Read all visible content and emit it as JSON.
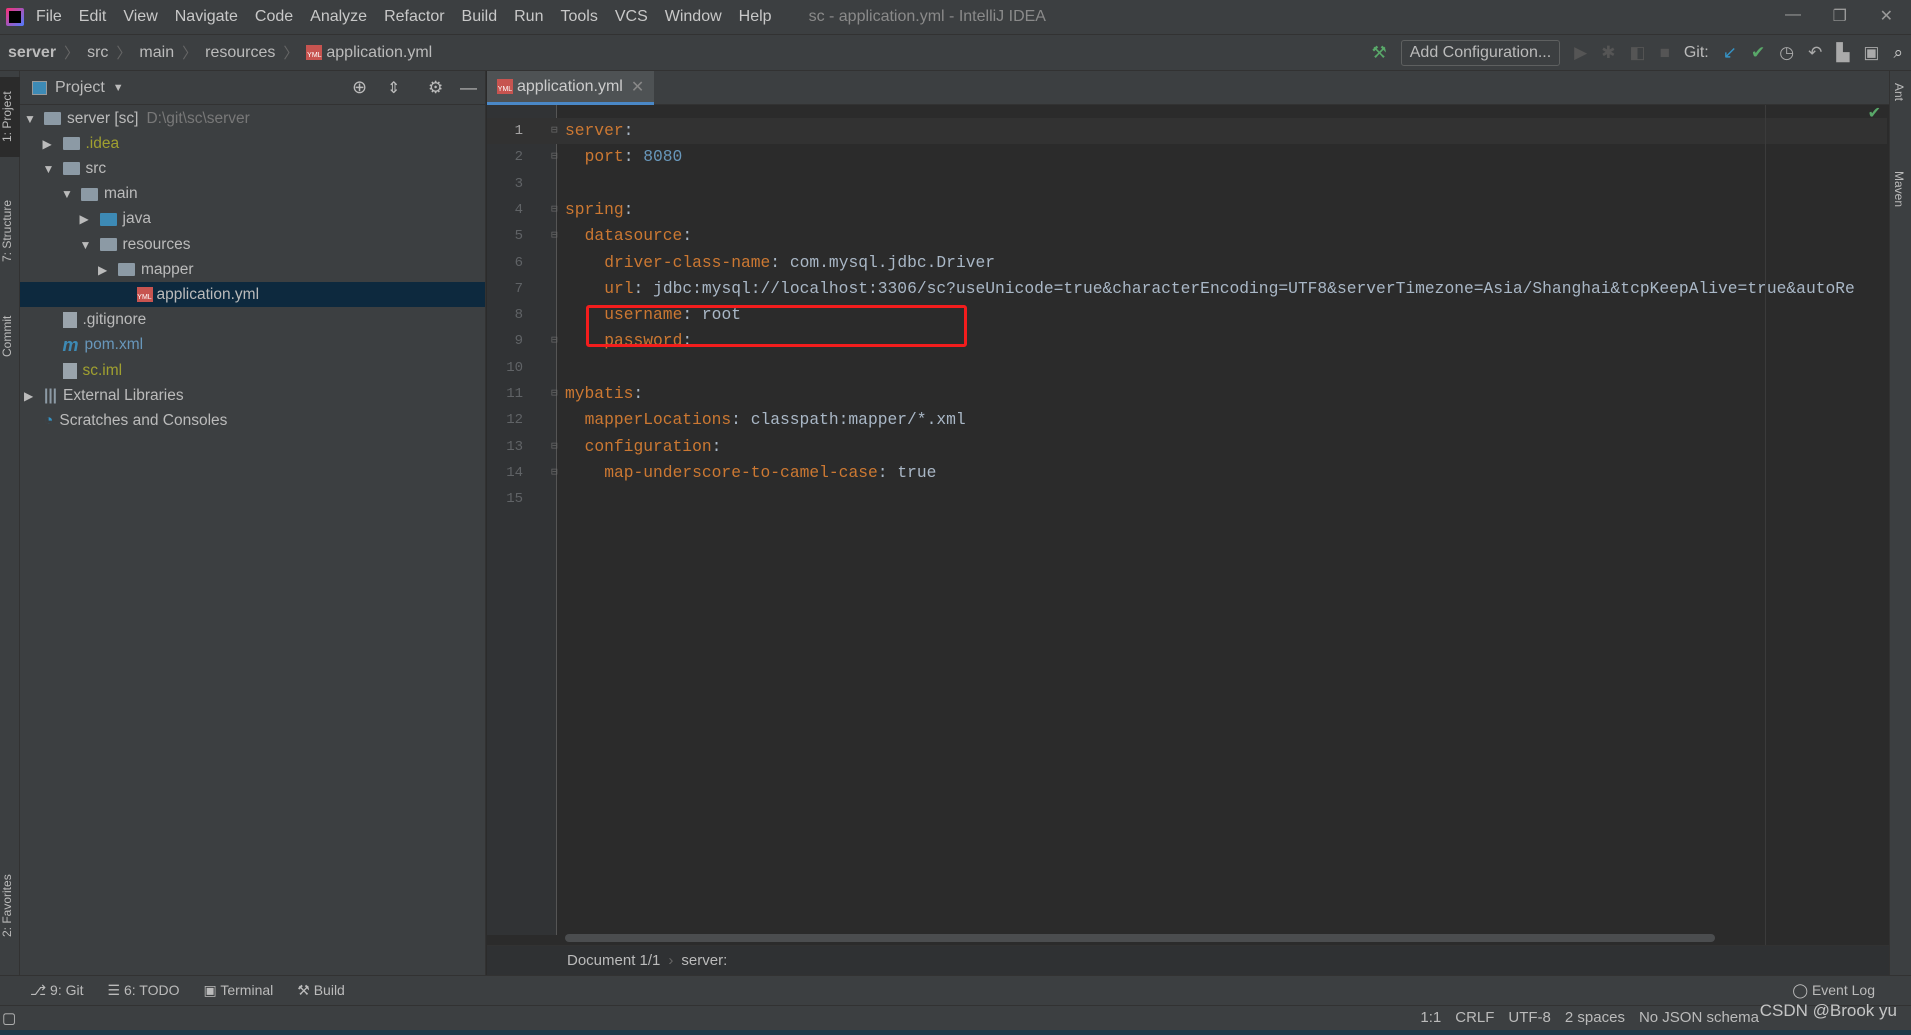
{
  "menu": {
    "items": [
      "File",
      "Edit",
      "View",
      "Navigate",
      "Code",
      "Analyze",
      "Refactor",
      "Build",
      "Run",
      "Tools",
      "VCS",
      "Window",
      "Help"
    ],
    "title": "sc - application.yml - IntelliJ IDEA"
  },
  "breadcrumb": [
    "server",
    "src",
    "main",
    "resources",
    "application.yml"
  ],
  "toolbar": {
    "add_config": "Add Configuration...",
    "git_label": "Git:"
  },
  "left_strip": [
    "1: Project",
    "7: Structure",
    "Commit",
    "2: Favorites"
  ],
  "right_strip": [
    "Ant",
    "Maven"
  ],
  "project": {
    "title": "Project",
    "tree": [
      {
        "label": "server [sc]",
        "extra": "D:\\git\\sc\\server",
        "depth": 0,
        "arrow": "open",
        "icon": "module"
      },
      {
        "label": ".idea",
        "depth": 1,
        "arrow": "closed",
        "icon": "folder",
        "color": "#a0a030"
      },
      {
        "label": "src",
        "depth": 1,
        "arrow": "open",
        "icon": "folder"
      },
      {
        "label": "main",
        "depth": 2,
        "arrow": "open",
        "icon": "folder"
      },
      {
        "label": "java",
        "depth": 3,
        "arrow": "closed",
        "icon": "folder-blue"
      },
      {
        "label": "resources",
        "depth": 3,
        "arrow": "open",
        "icon": "folder"
      },
      {
        "label": "mapper",
        "depth": 4,
        "arrow": "closed",
        "icon": "folder"
      },
      {
        "label": "application.yml",
        "depth": 5,
        "arrow": "",
        "icon": "yml",
        "selected": true
      },
      {
        "label": ".gitignore",
        "depth": 1,
        "arrow": "",
        "icon": "file"
      },
      {
        "label": "pom.xml",
        "depth": 1,
        "arrow": "",
        "icon": "maven",
        "color": "#6897bb"
      },
      {
        "label": "sc.iml",
        "depth": 1,
        "arrow": "",
        "icon": "file",
        "color": "#a0a030"
      },
      {
        "label": "External Libraries",
        "depth": 0,
        "arrow": "closed",
        "icon": "libs"
      },
      {
        "label": "Scratches and Consoles",
        "depth": 0,
        "arrow": "",
        "icon": "scratch"
      }
    ]
  },
  "editor": {
    "tab": "application.yml",
    "lines": [
      {
        "indent": 0,
        "key": "server",
        "val": ""
      },
      {
        "indent": 1,
        "key": "port",
        "val": "8080",
        "num": true
      },
      {
        "indent": 0,
        "key": "",
        "val": ""
      },
      {
        "indent": 0,
        "key": "spring",
        "val": ""
      },
      {
        "indent": 1,
        "key": "datasource",
        "val": ""
      },
      {
        "indent": 2,
        "key": "driver-class-name",
        "val": "com.mysql.jdbc.Driver"
      },
      {
        "indent": 2,
        "key": "url",
        "val": "jdbc:mysql://localhost:3306/sc?useUnicode=true&characterEncoding=UTF8&serverTimezone=Asia/Shanghai&tcpKeepAlive=true&autoRe"
      },
      {
        "indent": 2,
        "key": "username",
        "val": "root"
      },
      {
        "indent": 2,
        "key": "password",
        "val": ""
      },
      {
        "indent": 0,
        "key": "",
        "val": ""
      },
      {
        "indent": 0,
        "key": "mybatis",
        "val": ""
      },
      {
        "indent": 1,
        "key": "mapperLocations",
        "val": "classpath:mapper/*.xml"
      },
      {
        "indent": 1,
        "key": "configuration",
        "val": ""
      },
      {
        "indent": 2,
        "key": "map-underscore-to-camel-case",
        "val": "true"
      },
      {
        "indent": 0,
        "key": "",
        "val": ""
      }
    ],
    "breadcrumb": [
      "Document 1/1",
      "server:"
    ]
  },
  "toolwindows": [
    "9: Git",
    "6: TODO",
    "Terminal",
    "Build"
  ],
  "event_log": "Event Log",
  "status": [
    "1:1",
    "CRLF",
    "UTF-8",
    "2 spaces",
    "No JSON schema"
  ],
  "watermark": "CSDN @Brook yu",
  "colors": {
    "key": "#cc7832",
    "value": "#a9b7c6",
    "number": "#6897bb",
    "highlight": "#f31d1d",
    "selection": "#0d293e"
  }
}
